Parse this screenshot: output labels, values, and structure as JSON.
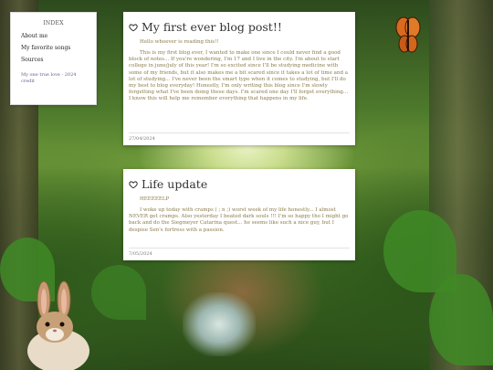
{
  "index": {
    "title": "INDEX",
    "links": [
      "About me",
      "My favorite songs",
      "Sources"
    ],
    "credit": "My one true love - 2024 credit"
  },
  "posts": [
    {
      "title": "My first ever blog post!!",
      "greeting": "Hello whoever is reading this!!",
      "body": "This is my first blog ever, I wanted to make one since I could never find a good block of notes... If you're wondering, I'm 17 and I live in the city. I'm about to start college in june/july of this year! I'm so excited since I'll be studying medicine with some of my friends, but it also makes me a bit scared since it takes a lot of time and a lot of studying... I've never been the smart type when it comes to studying, but I'll do my best to blog everyday! Honestly, I'm only writing this blog since I'm slowly forgetting what I've been doing these days. I'm scared one day I'll forget everything... I know this will help me remember everything that happens in my life.",
      "date": "27/04/2024"
    },
    {
      "title": "Life update",
      "greeting": "HEEEEELP",
      "body": "I woke up today with cramps ( ; n ;) worst week of my life honestly... I almost NEVER get cramps. Also yesterday I beated dark souls !!! I'm so happy tho I might go back and do the Siegmeyer Catarina quest... he seems like such a nice guy, but I despise Sen's fortress with a passion.",
      "date": "7/05/2024"
    }
  ],
  "icons": {
    "post_icon": "heart-outline-icon",
    "decoration_bottom_left": "bunny",
    "decoration_top_right": "butterfly"
  },
  "colors": {
    "body_text": "#8a7a4a",
    "title_text": "#333333",
    "credit_text": "#6a5a90",
    "card_bg": "#ffffff"
  }
}
